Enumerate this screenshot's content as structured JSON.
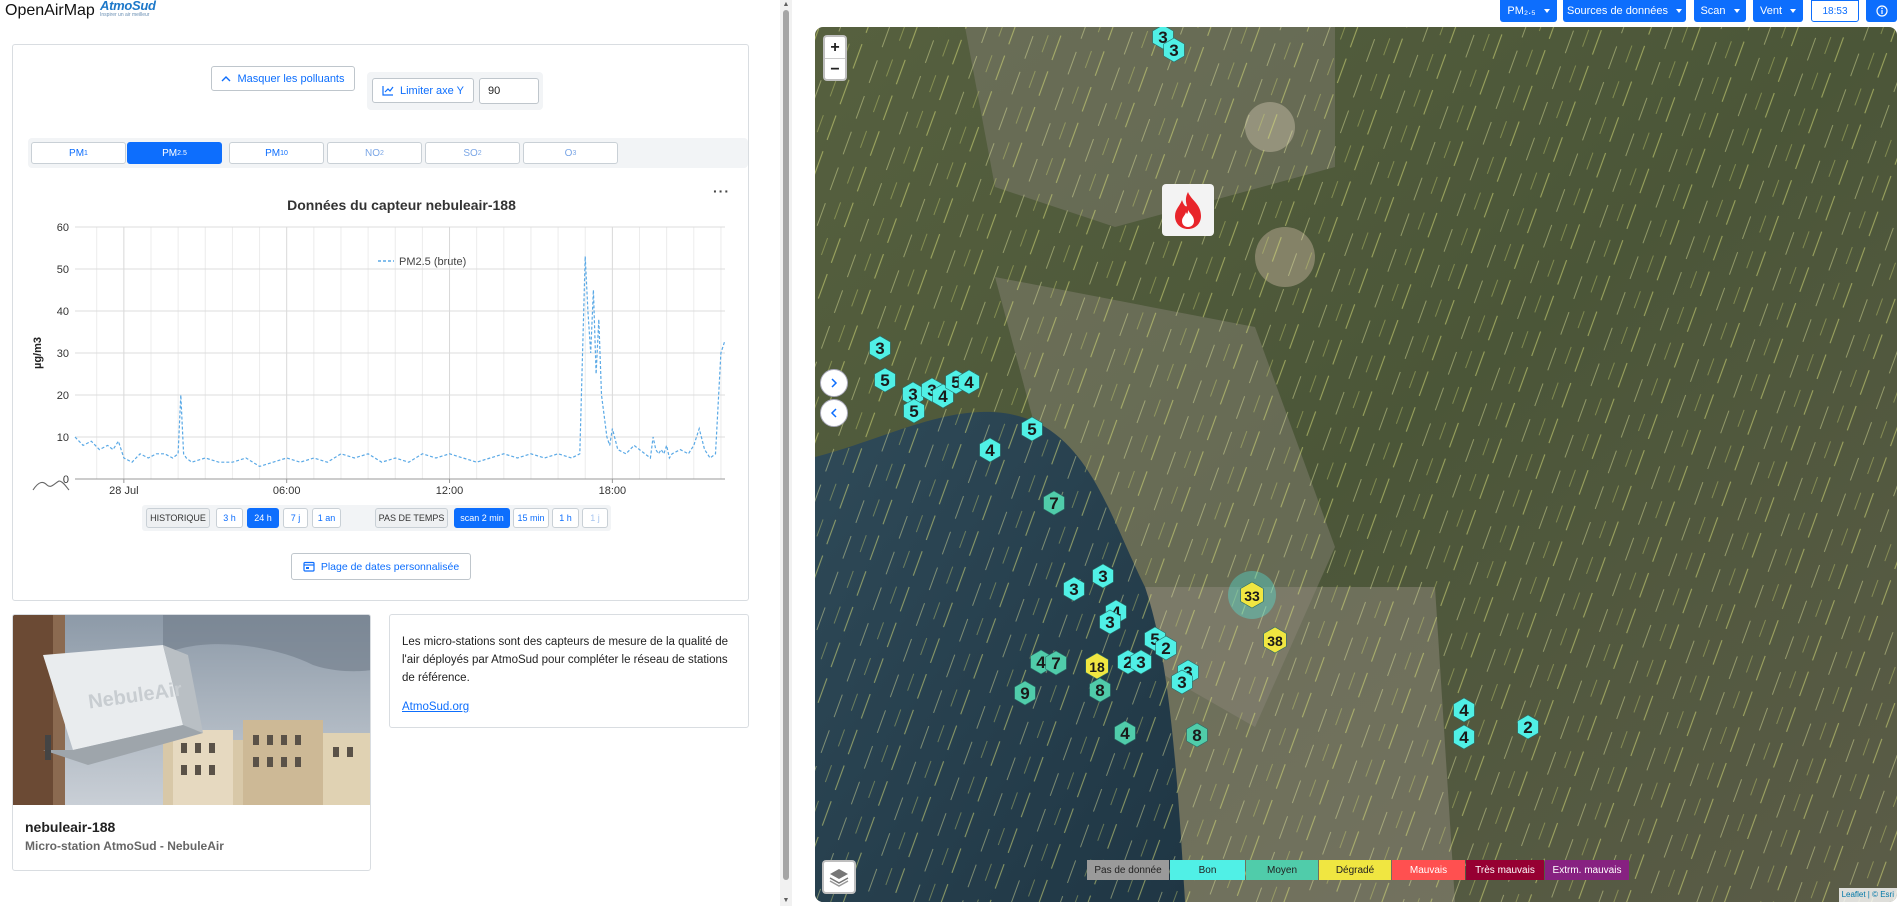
{
  "header": {
    "app_title": "OpenAirMap",
    "logo_title": "AtmoSud",
    "logo_subtitle": "Inspirer un air meilleur"
  },
  "controls": {
    "hide_pollutants_label": "Masquer les polluants",
    "limit_y_label": "Limiter axe Y",
    "y_limit_value": "90"
  },
  "pollutant_tabs": [
    {
      "label": "PM",
      "sub": "1",
      "state": "normal"
    },
    {
      "label": "PM",
      "sub": "2.5",
      "state": "active"
    },
    {
      "label": "PM",
      "sub": "10",
      "state": "normal"
    },
    {
      "label": "NO",
      "sub": "2",
      "state": "disabled"
    },
    {
      "label": "SO",
      "sub": "2",
      "state": "disabled"
    },
    {
      "label": "O",
      "sub": "3",
      "state": "disabled"
    }
  ],
  "chart_menu_label": "···",
  "chart_data": {
    "type": "line",
    "title": "Données du capteur nebuleair-188",
    "ylabel": "µg/m3",
    "xlabel": "",
    "ylim": [
      0,
      60
    ],
    "yticks": [
      0,
      10,
      20,
      30,
      40,
      50,
      60
    ],
    "xlim": [
      -1.8,
      22.15
    ],
    "xticks": [
      {
        "x": 0,
        "label": "28 Jul"
      },
      {
        "x": 6,
        "label": "06:00"
      },
      {
        "x": 12,
        "label": "12:00"
      },
      {
        "x": 18,
        "label": "18:00"
      }
    ],
    "series": [
      {
        "name": "PM2.5 (brute)",
        "color": "#5aa9e6",
        "style": "dashed",
        "x": [
          -1.8,
          -1.5,
          -1.2,
          -0.9,
          -0.6,
          -0.4,
          -0.2,
          0.0,
          0.3,
          0.6,
          0.9,
          1.2,
          1.5,
          1.8,
          2.0,
          2.1,
          2.2,
          2.3,
          2.5,
          3.0,
          3.5,
          4.0,
          4.5,
          5.0,
          5.5,
          6.0,
          6.5,
          7.0,
          7.5,
          8.0,
          8.5,
          9.0,
          9.5,
          10.0,
          10.5,
          11.0,
          11.5,
          12.0,
          12.5,
          13.0,
          13.5,
          14.0,
          14.5,
          15.0,
          15.5,
          16.0,
          16.5,
          16.8,
          17.0,
          17.1,
          17.2,
          17.3,
          17.4,
          17.5,
          17.6,
          17.7,
          17.8,
          17.9,
          18.0,
          18.2,
          18.5,
          18.8,
          19.0,
          19.2,
          19.4,
          19.5,
          19.6,
          19.7,
          19.8,
          19.9,
          20.0,
          20.1,
          20.2,
          20.5,
          20.8,
          21.0,
          21.2,
          21.4,
          21.6,
          21.8,
          22.0,
          22.15
        ],
        "y": [
          10,
          8,
          9,
          7,
          8,
          7,
          9,
          5,
          4,
          6,
          5,
          6,
          6,
          5,
          6,
          20,
          6,
          5,
          4,
          5,
          4,
          4,
          5,
          3,
          4,
          5,
          4,
          5,
          4,
          6,
          5,
          6,
          4,
          5,
          4,
          6,
          5,
          6,
          5,
          4,
          5,
          6,
          5,
          6,
          5,
          6,
          5,
          6,
          53,
          40,
          30,
          45,
          25,
          38,
          20,
          15,
          10,
          8,
          12,
          7,
          6,
          8,
          7,
          6,
          5,
          10,
          7,
          6,
          7,
          6,
          8,
          5,
          6,
          7,
          6,
          8,
          12,
          7,
          5,
          6,
          30,
          33
        ]
      }
    ],
    "legend": "top-center",
    "grid": true
  },
  "range_bar": {
    "history_label": "HISTORIQUE",
    "ranges": [
      {
        "label": "3 h",
        "state": "normal"
      },
      {
        "label": "24 h",
        "state": "active"
      },
      {
        "label": "7 j",
        "state": "normal"
      },
      {
        "label": "1 an",
        "state": "normal"
      }
    ],
    "step_label": "PAS DE TEMPS",
    "steps": [
      {
        "label": "scan 2 min",
        "state": "active"
      },
      {
        "label": "15 min",
        "state": "normal"
      },
      {
        "label": "1 h",
        "state": "normal"
      },
      {
        "label": "1 j",
        "state": "disabled"
      }
    ]
  },
  "custom_range_label": "Plage de dates personnalisée",
  "station_card": {
    "title": "nebuleair-188",
    "subtitle": "Micro-station AtmoSud - NebuleAir",
    "photo_caption": "NebuleAir"
  },
  "info_card": {
    "text": "Les micro-stations sont des capteurs de mesure de la qualité de l'air déployés par AtmoSud pour compléter le réseau de stations de référence.",
    "link_label": "AtmoSud.org"
  },
  "toolbar": {
    "pollutant_dropdown": "PM₂.₅",
    "sources_dropdown": "Sources de données",
    "scan_dropdown": "Scan",
    "wind_dropdown": "Vent",
    "time": "18:53",
    "info_icon": "info-icon"
  },
  "map": {
    "zoom_in": "+",
    "zoom_out": "−",
    "markers": [
      {
        "value": "3",
        "category": "Bon",
        "x": 1163,
        "y": 37
      },
      {
        "value": "3",
        "category": "Bon",
        "x": 1174,
        "y": 50
      },
      {
        "value": "3",
        "category": "Bon",
        "x": 880,
        "y": 348
      },
      {
        "value": "5",
        "category": "Bon",
        "x": 885,
        "y": 380
      },
      {
        "value": "3",
        "category": "Bon",
        "x": 913,
        "y": 394
      },
      {
        "value": "3",
        "category": "Bon",
        "x": 932,
        "y": 390
      },
      {
        "value": "4",
        "category": "Bon",
        "x": 943,
        "y": 396
      },
      {
        "value": "5",
        "category": "Bon",
        "x": 956,
        "y": 382
      },
      {
        "value": "4",
        "category": "Bon",
        "x": 969,
        "y": 382
      },
      {
        "value": "5",
        "category": "Bon",
        "x": 914,
        "y": 411
      },
      {
        "value": "5",
        "category": "Bon",
        "x": 1032,
        "y": 429
      },
      {
        "value": "4",
        "category": "Bon",
        "x": 990,
        "y": 450
      },
      {
        "value": "7",
        "category": "Moyen",
        "x": 1054,
        "y": 503
      },
      {
        "value": "3",
        "category": "Bon",
        "x": 1103,
        "y": 576
      },
      {
        "value": "3",
        "category": "Bon",
        "x": 1074,
        "y": 589
      },
      {
        "value": "4",
        "category": "Bon",
        "x": 1116,
        "y": 612
      },
      {
        "value": "3",
        "category": "Bon",
        "x": 1110,
        "y": 622
      },
      {
        "value": "33",
        "category": "Dégradé",
        "x": 1252,
        "y": 595
      },
      {
        "value": "38",
        "category": "Dégradé",
        "x": 1275,
        "y": 640
      },
      {
        "value": "5",
        "category": "Bon",
        "x": 1155,
        "y": 639
      },
      {
        "value": "2",
        "category": "Bon",
        "x": 1166,
        "y": 648
      },
      {
        "value": "4",
        "category": "Moyen",
        "x": 1041,
        "y": 662
      },
      {
        "value": "7",
        "category": "Moyen",
        "x": 1056,
        "y": 663
      },
      {
        "value": "18",
        "category": "Dégradé",
        "x": 1097,
        "y": 666
      },
      {
        "value": "2",
        "category": "Bon",
        "x": 1128,
        "y": 662
      },
      {
        "value": "3",
        "category": "Bon",
        "x": 1141,
        "y": 662
      },
      {
        "value": "3",
        "category": "Bon",
        "x": 1188,
        "y": 672
      },
      {
        "value": "3",
        "category": "Bon",
        "x": 1182,
        "y": 682
      },
      {
        "value": "9",
        "category": "Moyen",
        "x": 1025,
        "y": 693
      },
      {
        "value": "8",
        "category": "Moyen",
        "x": 1100,
        "y": 690
      },
      {
        "value": "4",
        "category": "Bon",
        "x": 1464,
        "y": 710
      },
      {
        "value": "2",
        "category": "Bon",
        "x": 1528,
        "y": 727
      },
      {
        "value": "4",
        "category": "Bon",
        "x": 1464,
        "y": 737
      },
      {
        "value": "4",
        "category": "Moyen",
        "x": 1125,
        "y": 733
      },
      {
        "value": "8",
        "category": "Moyen",
        "x": 1197,
        "y": 735
      }
    ],
    "legend": [
      {
        "label": "Pas de donnée",
        "bg": "#9a9a9a",
        "fg": "#222222"
      },
      {
        "label": "Bon",
        "bg": "#50f0e6",
        "fg": "#222222"
      },
      {
        "label": "Moyen",
        "bg": "#50ccaa",
        "fg": "#222222"
      },
      {
        "label": "Dégradé",
        "bg": "#f0e641",
        "fg": "#222222"
      },
      {
        "label": "Mauvais",
        "bg": "#ff5050",
        "fg": "#ffffff"
      },
      {
        "label": "Très mauvais",
        "bg": "#960032",
        "fg": "#ffffff"
      },
      {
        "label": "Extrm. mauvais",
        "bg": "#872181",
        "fg": "#ffffff"
      }
    ],
    "attribution": "Leaflet | © Esri"
  },
  "colors": {
    "accent": "#0d6efd",
    "bon": "#50f0e6",
    "moyen": "#50ccaa",
    "degrade": "#f0e641"
  }
}
